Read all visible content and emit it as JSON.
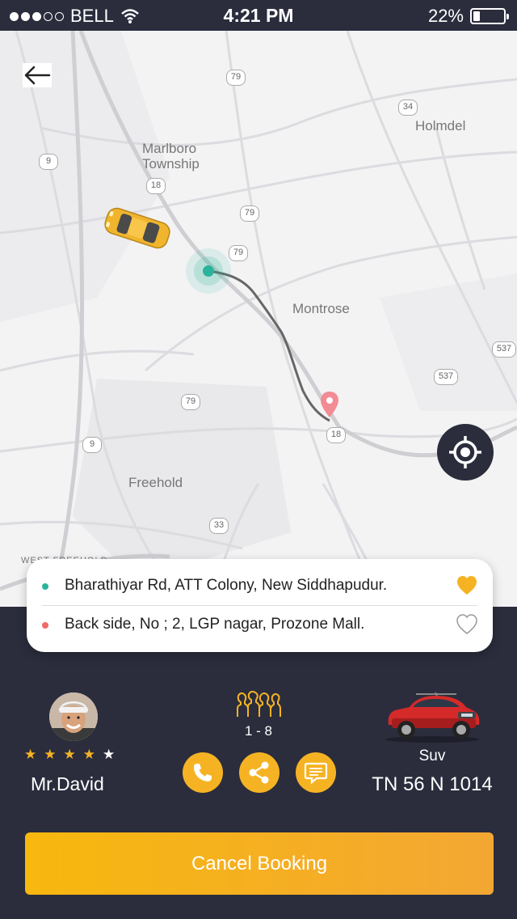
{
  "status_bar": {
    "carrier": "BELL",
    "time": "4:21 PM",
    "battery": "22%",
    "battery_level": 0.22,
    "signal_bars_filled": 3,
    "signal_bars_total": 5
  },
  "map": {
    "labels": {
      "marlboro": "Marlboro\nTownship",
      "holmdel": "Holmdel",
      "montrose": "Montrose",
      "freehold": "Freehold",
      "west_freehold": "WEST FREEHOLD"
    },
    "shields": [
      "79",
      "34",
      "9",
      "18",
      "79",
      "79",
      "537",
      "537",
      "79",
      "9",
      "18",
      "33"
    ]
  },
  "addresses": {
    "pickup": {
      "text": "Bharathiyar Rd, ATT Colony, New Siddhapudur.",
      "dot_color": "#2bb39b",
      "favorited": true
    },
    "drop": {
      "text": "Back side, No ; 2, LGP nagar, Prozone Mall.",
      "dot_color": "#f06a6a",
      "favorited": false
    }
  },
  "driver": {
    "name": "Mr.David",
    "rating": 4,
    "rating_max": 5
  },
  "seats": {
    "range": "1 - 8"
  },
  "vehicle": {
    "type": "Suv",
    "plate": "TN 56 N 1014"
  },
  "actions": {
    "call": "phone-icon",
    "share": "share-icon",
    "chat": "chat-icon"
  },
  "cancel_button": "Cancel Booking",
  "colors": {
    "accent": "#f5b324",
    "panel": "#2b2d3d",
    "pickup": "#2bb39b",
    "drop": "#f06a6a"
  }
}
